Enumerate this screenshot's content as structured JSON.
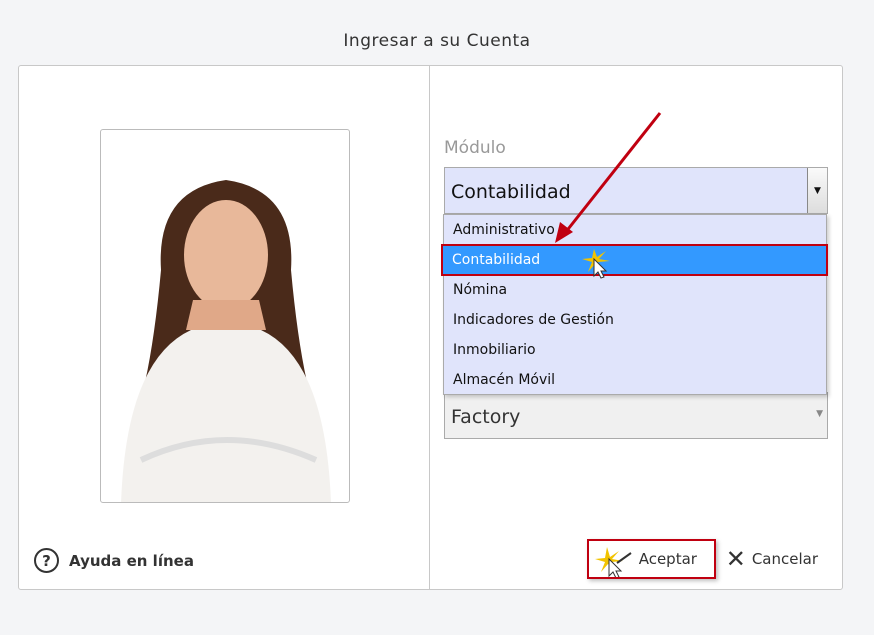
{
  "title": "Ingresar a su Cuenta",
  "help": "Ayuda en línea",
  "module": {
    "label": "Módulo",
    "selected": "Contabilidad",
    "options": [
      "Administrativo",
      "Contabilidad",
      "Nómina",
      "Indicadores de Gestión",
      "Inmobiliario",
      "Almacén Móvil"
    ]
  },
  "second_select": "Factory",
  "buttons": {
    "accept": "Aceptar",
    "cancel": "Cancelar"
  },
  "colors": {
    "highlight": "#3399ff",
    "annotation": "#c00010"
  }
}
